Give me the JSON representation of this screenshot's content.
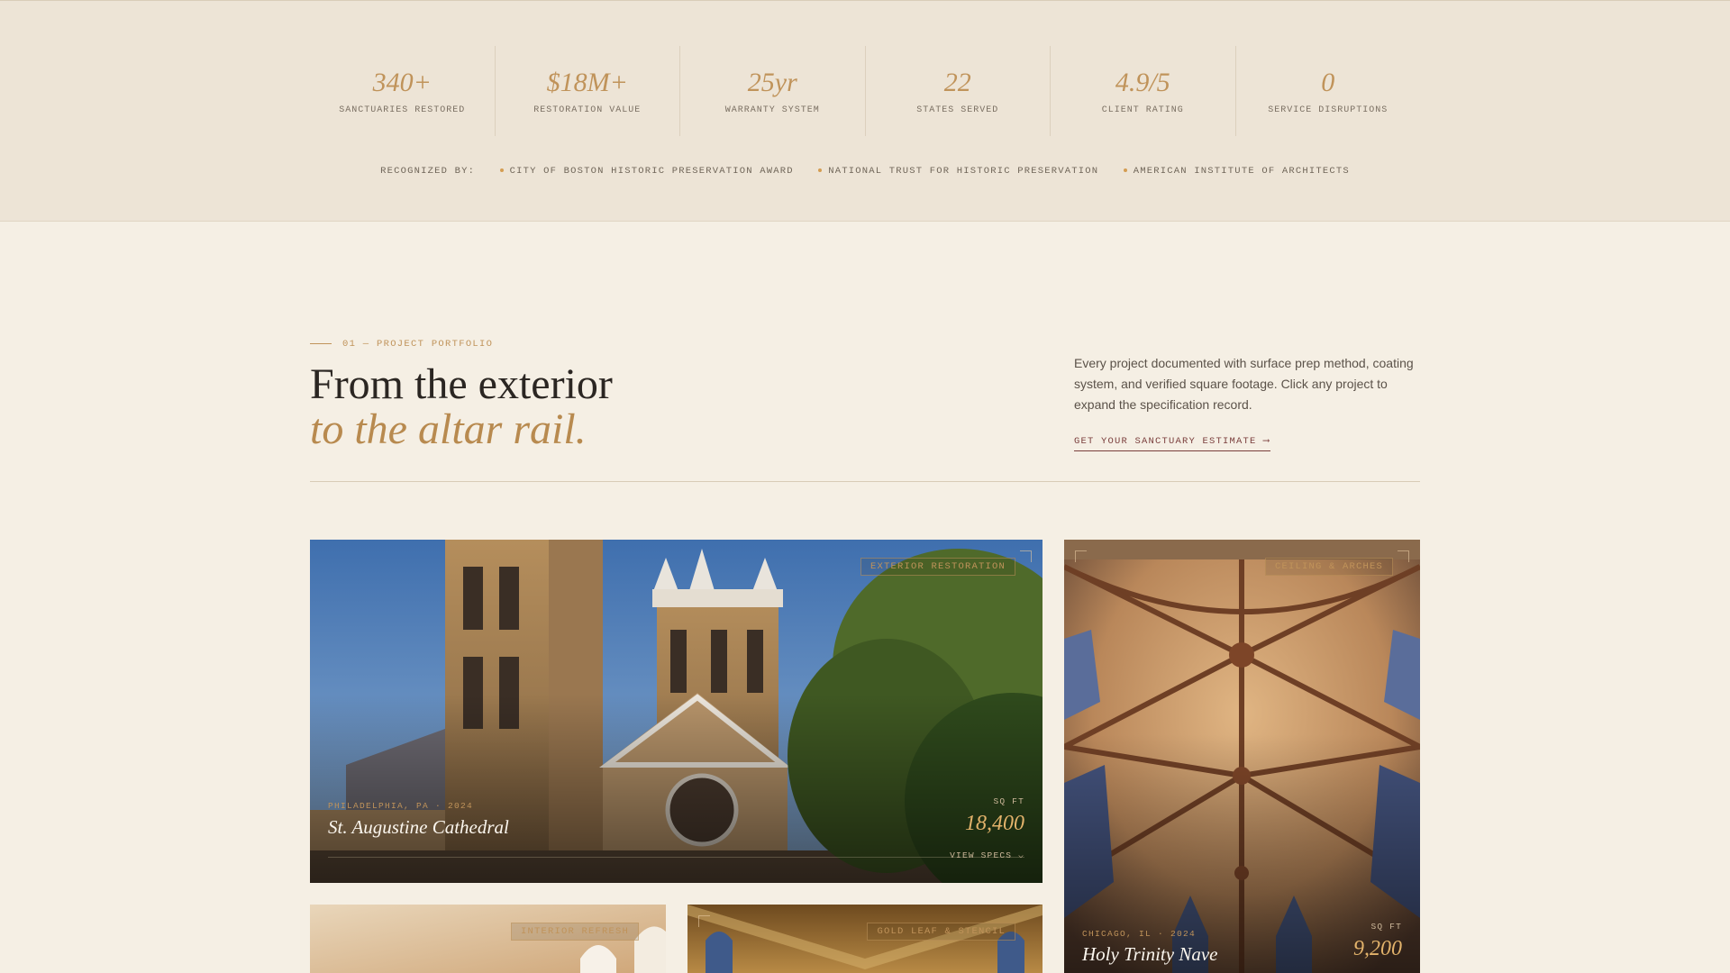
{
  "stats": [
    {
      "value": "340+",
      "label": "SANCTUARIES RESTORED"
    },
    {
      "value": "$18M+",
      "label": "RESTORATION VALUE"
    },
    {
      "value": "25yr",
      "label": "WARRANTY SYSTEM"
    },
    {
      "value": "22",
      "label": "STATES SERVED"
    },
    {
      "value": "4.9/5",
      "label": "CLIENT RATING"
    },
    {
      "value": "0",
      "label": "SERVICE DISRUPTIONS"
    }
  ],
  "recognized": {
    "label": "RECOGNIZED BY:",
    "items": [
      "CITY OF BOSTON HISTORIC PRESERVATION AWARD",
      "NATIONAL TRUST FOR HISTORIC PRESERVATION",
      "AMERICAN INSTITUTE OF ARCHITECTS"
    ]
  },
  "section": {
    "eyebrow": "01 — PROJECT PORTFOLIO",
    "headline_1": "From the exterior",
    "headline_2": "to the altar rail.",
    "intro": "Every project documented with surface prep method, coating system, and verified square footage. Click any project to expand the specification record.",
    "cta": "GET YOUR SANCTUARY ESTIMATE ⟶"
  },
  "projects": [
    {
      "tag": "EXTERIOR RESTORATION",
      "meta": "PHILADELPHIA, PA · 2024",
      "title": "St. Augustine Cathedral",
      "sqft_label": "SQ FT",
      "sqft": "18,400",
      "view": "VIEW SPECS ⌵"
    },
    {
      "tag": "CEILING & ARCHES",
      "meta": "CHICAGO, IL · 2024",
      "title": "Holy Trinity Nave",
      "sqft_label": "SQ FT",
      "sqft": "9,200"
    },
    {
      "tag": "INTERIOR REFRESH"
    },
    {
      "tag": "GOLD LEAF & STENCIL"
    }
  ],
  "colors": {
    "accent": "#c0935a",
    "band": "#ede4d6",
    "page": "#f5efe4",
    "cta": "#7a3e3c"
  }
}
